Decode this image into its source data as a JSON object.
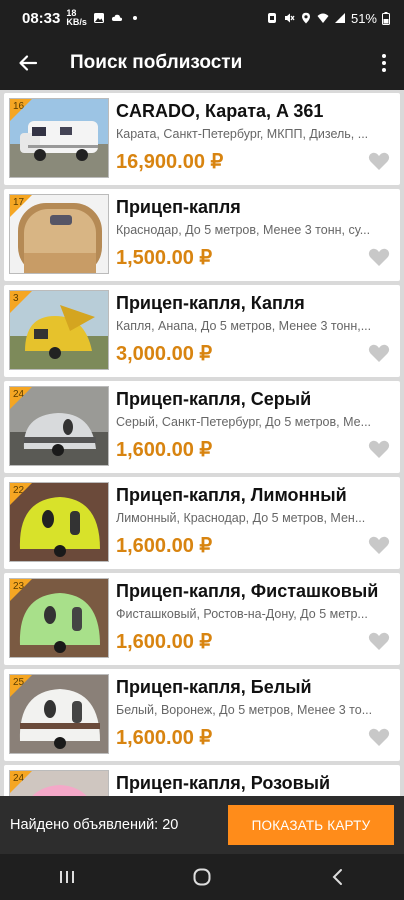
{
  "status": {
    "time": "08:33",
    "small_top": "18",
    "small_bottom": "KB/s",
    "battery": "51%"
  },
  "header": {
    "title": "Поиск поблизости",
    "back_icon": "arrow-left-icon",
    "menu_icon": "more-vertical-icon"
  },
  "listings": [
    {
      "badge": "16",
      "title": "CARADO, Карата, A 361",
      "desc": "Карата, Санкт-Петербург, МКПП, Дизель, ...",
      "price": "16,900.00 ₽"
    },
    {
      "badge": "17",
      "title": "Прицеп-капля",
      "desc": "Краснодар, До 5 метров, Менее 3 тонн, су...",
      "price": "1,500.00 ₽"
    },
    {
      "badge": "3",
      "title": "Прицеп-капля, Капля",
      "desc": "Капля, Анапа, До 5 метров, Менее 3 тонн,...",
      "price": "3,000.00 ₽"
    },
    {
      "badge": "24",
      "title": "Прицеп-капля, Серый",
      "desc": "Серый, Санкт-Петербург, До 5 метров, Ме...",
      "price": "1,600.00 ₽"
    },
    {
      "badge": "22",
      "title": "Прицеп-капля, Лимонный",
      "desc": "Лимонный, Краснодар, До 5 метров, Мен...",
      "price": "1,600.00 ₽"
    },
    {
      "badge": "23",
      "title": "Прицеп-капля, Фисташковый",
      "desc": "Фисташковый, Ростов-на-Дону, До 5 метр...",
      "price": "1,600.00 ₽"
    },
    {
      "badge": "25",
      "title": "Прицеп-капля, Белый",
      "desc": "Белый, Воронеж, До 5 метров, Менее 3 то...",
      "price": "1,600.00 ₽"
    },
    {
      "badge": "24",
      "title": "Прицеп-капля, Розовый",
      "desc": "",
      "price": ""
    }
  ],
  "footer": {
    "found_text": "Найдено объявлений: 20",
    "map_button": "ПОКАЗАТЬ КАРТУ"
  },
  "colors": {
    "accent": "#ff8c1a",
    "price": "#d88410",
    "badge": "#f5a623"
  }
}
